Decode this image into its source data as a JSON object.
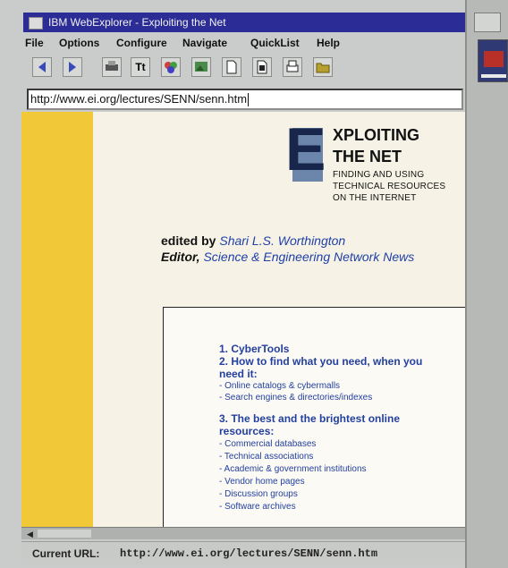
{
  "window": {
    "title": "IBM WebExplorer - Exploiting the Net"
  },
  "menu": [
    "File",
    "Options",
    "Configure",
    "Navigate",
    "QuickList",
    "Help"
  ],
  "toolbar": {
    "buttons": [
      {
        "icon": "back-arrow-icon",
        "color": "#3a4ab8"
      },
      {
        "icon": "forward-arrow-icon",
        "color": "#3a4ab8"
      },
      {
        "icon": "printer-icon",
        "color": "#555555"
      },
      {
        "icon": "text-format-icon",
        "label": "Tt"
      },
      {
        "icon": "color-palette-icon",
        "color": "#cc4040"
      },
      {
        "icon": "image-icon",
        "color": "#4a8a4a"
      },
      {
        "icon": "document-icon"
      },
      {
        "icon": "document-icon"
      },
      {
        "icon": "print-icon"
      },
      {
        "icon": "folder-icon",
        "color": "#b8a030"
      }
    ]
  },
  "address": {
    "url": "http://www.ei.org/lectures/SENN/senn.htm"
  },
  "page": {
    "logo_letter": "E",
    "heading_line1": "XPLOITING",
    "heading_line2": "THE NET",
    "subtitle": [
      "FINDING AND USING",
      "TECHNICAL RESOURCES",
      "ON THE INTERNET"
    ],
    "edited_by_label": "edited by",
    "editor_name": "Shari L.S. Worthington",
    "editor_role_label": "Editor,",
    "editor_publication": "Science & Engineering Network News",
    "toc": [
      {
        "text": "1. CyberTools",
        "type": "heading"
      },
      {
        "text": "2. How to find what you need, when you",
        "type": "heading"
      },
      {
        "text": "need it:",
        "type": "heading"
      },
      {
        "text": "- Online catalogs & cybermalls",
        "type": "sub"
      },
      {
        "text": "- Search engines & directories/indexes",
        "type": "sub"
      },
      {
        "text": "3. The best and the brightest online",
        "type": "heading"
      },
      {
        "text": "resources:",
        "type": "heading"
      },
      {
        "text": "- Commercial databases",
        "type": "sub"
      },
      {
        "text": "- Technical associations",
        "type": "sub"
      },
      {
        "text": "- Academic & government institutions",
        "type": "sub"
      },
      {
        "text": "- Vendor home pages",
        "type": "sub"
      },
      {
        "text": "- Discussion groups",
        "type": "sub"
      },
      {
        "text": "- Software archives",
        "type": "sub"
      }
    ]
  },
  "status": {
    "label": "Current URL:",
    "url": "http://www.ei.org/lectures/SENN/senn.htm"
  },
  "colors": {
    "title_bar": "#2c2c96",
    "left_strip": "#f0c838",
    "link_blue": "#2440a0",
    "logo_dark": "#17264a"
  }
}
